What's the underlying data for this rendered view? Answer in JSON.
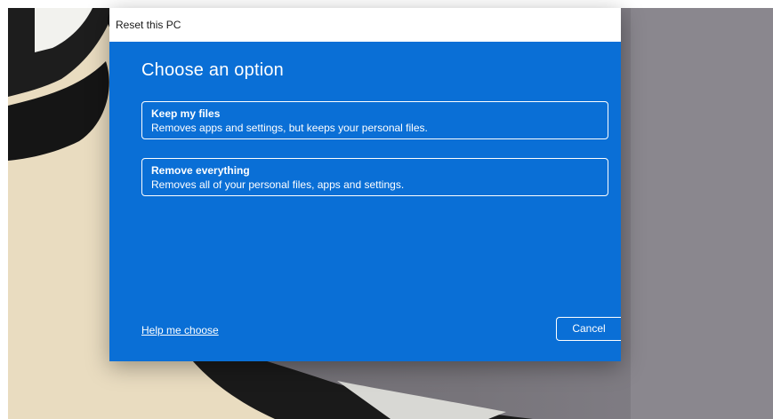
{
  "dialog": {
    "title": "Reset this PC",
    "heading": "Choose an option",
    "options": [
      {
        "title": "Keep my files",
        "description": "Removes apps and settings, but keeps your personal files."
      },
      {
        "title": "Remove everything",
        "description": "Removes all of your personal files, apps and settings."
      }
    ],
    "help_link": "Help me choose",
    "cancel_label": "Cancel"
  },
  "colors": {
    "dialog_background": "#0a6fd6",
    "titlebar_background": "#ffffff",
    "text": "#ffffff"
  }
}
